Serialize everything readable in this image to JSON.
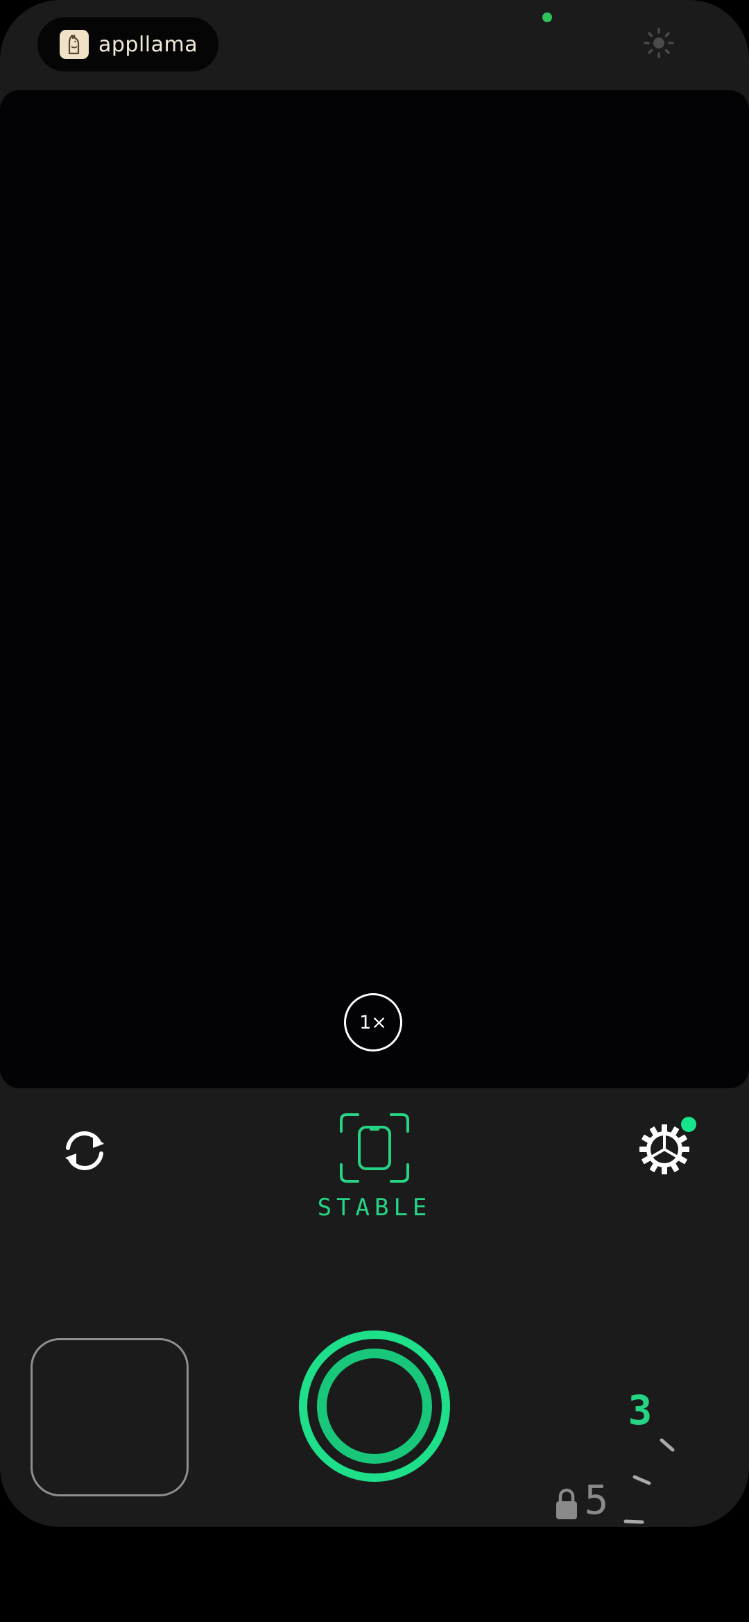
{
  "header": {
    "brand_name": "appllama",
    "brand_logo_icon": "llama-logo-icon",
    "brightness_icon": "brightness-icon",
    "privacy_indicator_color": "#2fc25b"
  },
  "viewfinder": {
    "zoom_label": "1×"
  },
  "controls": {
    "flip_icon": "camera-flip-icon",
    "stability_icon": "phone-stability-icon",
    "stability_label": "STABLE",
    "settings_icon": "gear-icon",
    "settings_badge_color": "#17e58c"
  },
  "bottom": {
    "gallery_icon": "gallery-thumbnail",
    "shutter_icon": "shutter-icon",
    "timer_value": "3",
    "timer_next_value": "5",
    "lock_icon": "lock-icon"
  },
  "colors": {
    "accent": "#25d584",
    "shutter_outer": "#1fe08a",
    "shutter_inner": "#19c77a",
    "background": "#1b1b1c",
    "viewfinder": "#030305"
  }
}
